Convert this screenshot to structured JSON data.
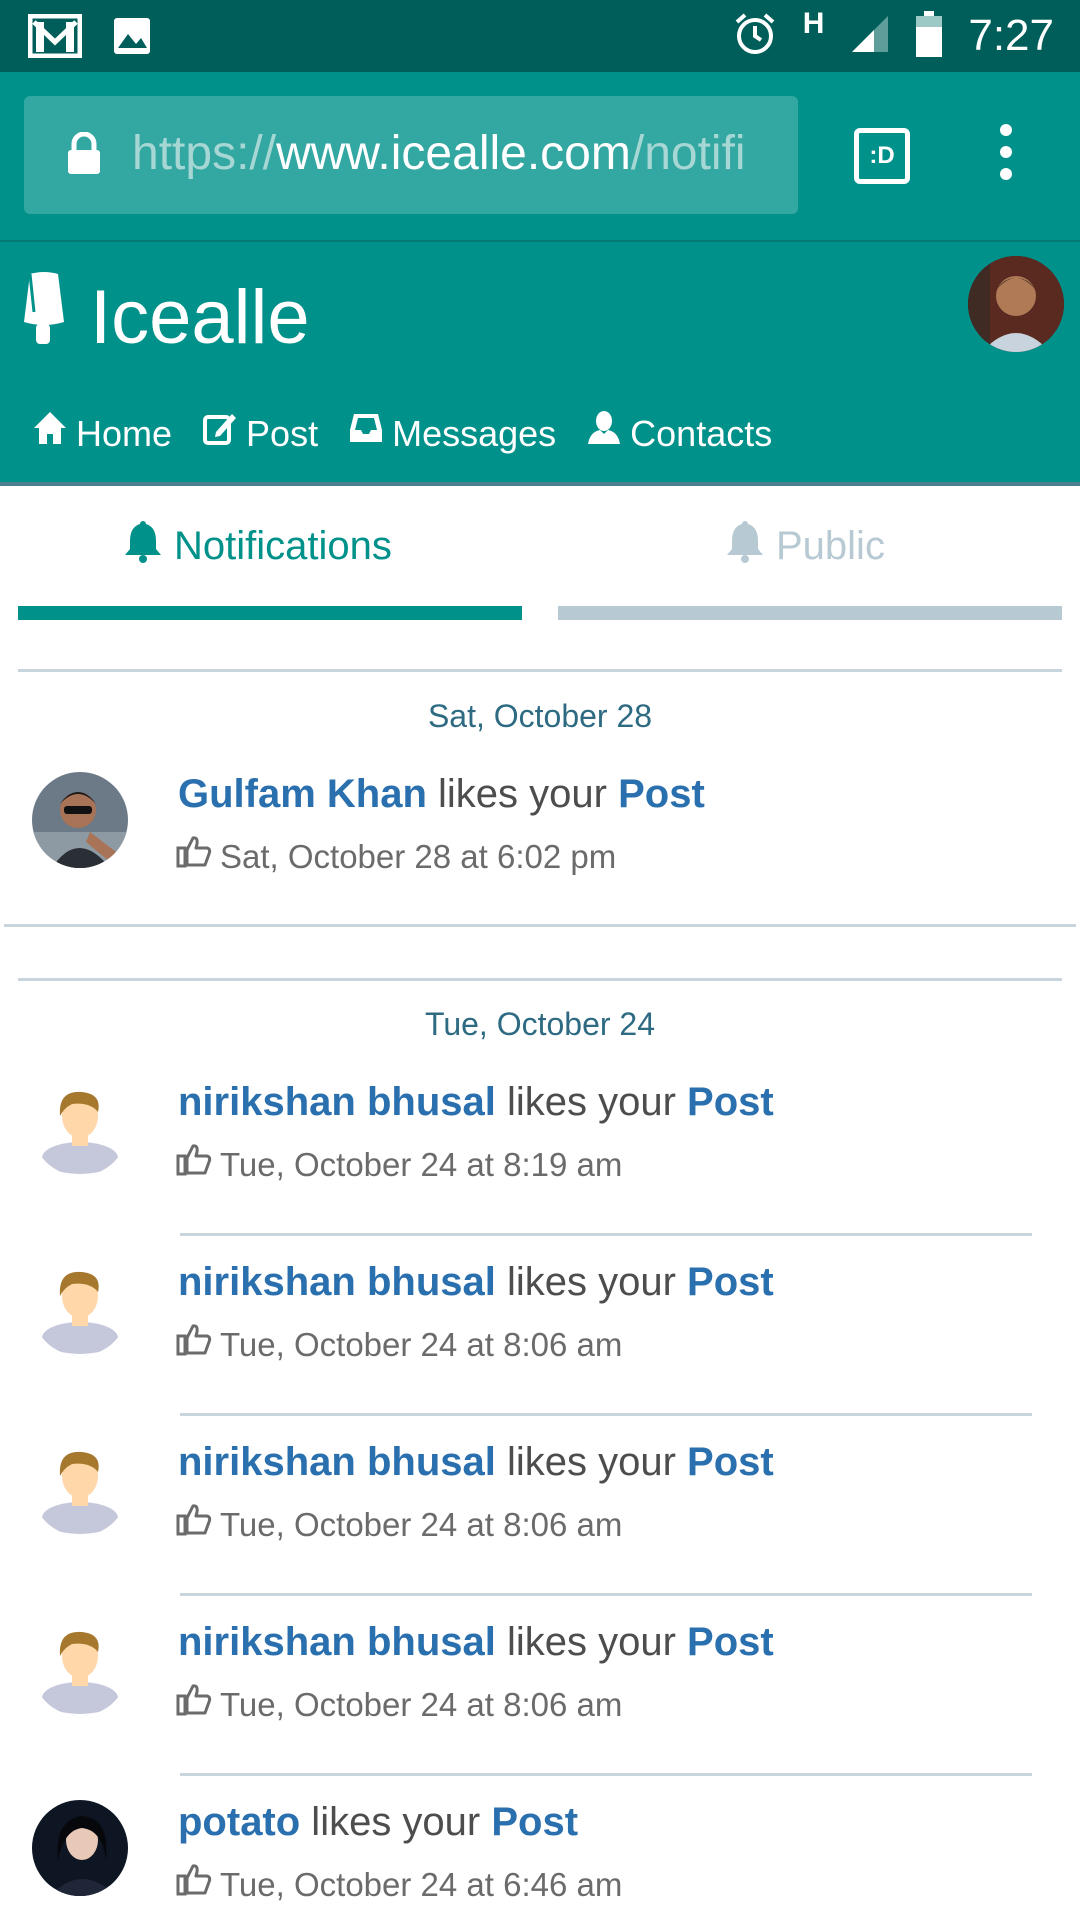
{
  "status_bar": {
    "time": "7:27",
    "network": "H",
    "icons": [
      "gmail-icon",
      "image-icon",
      "alarm-icon",
      "signal-icon",
      "battery-icon"
    ]
  },
  "browser": {
    "url_scheme": "https://",
    "url_host": "www.icealle.com",
    "url_path": "/notifi",
    "screen_button": ":D"
  },
  "site": {
    "logo_text": "Icealle",
    "nav": [
      {
        "label": "Home",
        "icon": "home-icon"
      },
      {
        "label": "Post",
        "icon": "edit-icon"
      },
      {
        "label": "Messages",
        "icon": "inbox-icon"
      },
      {
        "label": "Contacts",
        "icon": "user-icon"
      }
    ]
  },
  "tabs": [
    {
      "label": "Notifications",
      "active": true
    },
    {
      "label": "Public",
      "active": false
    }
  ],
  "groups": [
    {
      "date": "Sat, October 28",
      "items": [
        {
          "name": "Gulfam Khan",
          "action": " likes your ",
          "object": "Post",
          "time": "Sat, October 28 at 6:02 pm",
          "avatar": "photo-1"
        }
      ]
    },
    {
      "date": "Tue, October 24",
      "items": [
        {
          "name": "nirikshan bhusal",
          "action": " likes your ",
          "object": "Post",
          "time": "Tue, October 24 at 8:19 am",
          "avatar": "default"
        },
        {
          "name": "nirikshan bhusal",
          "action": " likes your ",
          "object": "Post",
          "time": "Tue, October 24 at 8:06 am",
          "avatar": "default"
        },
        {
          "name": "nirikshan bhusal",
          "action": " likes your ",
          "object": "Post",
          "time": "Tue, October 24 at 8:06 am",
          "avatar": "default"
        },
        {
          "name": "nirikshan bhusal",
          "action": " likes your ",
          "object": "Post",
          "time": "Tue, October 24 at 8:06 am",
          "avatar": "default"
        },
        {
          "name": "potato",
          "action": " likes your ",
          "object": "Post",
          "time": "Tue, October 24 at 6:46 am",
          "avatar": "photo-2"
        }
      ]
    }
  ],
  "colors": {
    "status_bar": "#005e5a",
    "brand": "#00918a",
    "link": "#2a6fae",
    "tab_inactive": "#b7c9d3"
  }
}
